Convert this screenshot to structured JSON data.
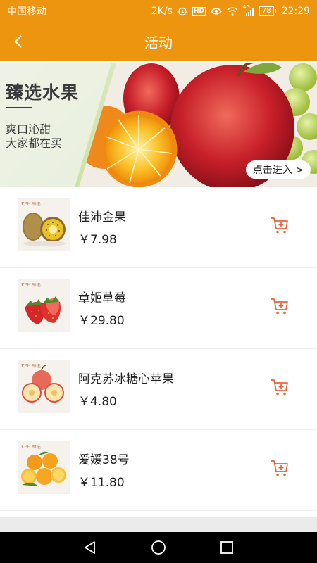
{
  "status_bar": {
    "carrier": "中国移动",
    "speed": "2K/s",
    "hd": "HD",
    "network": "4G",
    "battery": "78",
    "time": "22:29"
  },
  "header": {
    "title": "活动",
    "back_icon": "chevron-left-icon"
  },
  "banner": {
    "title": "臻选水果",
    "subtitle_line1": "爽口沁甜",
    "subtitle_line2": "大家都在买",
    "cta": "点击进入 >"
  },
  "products": [
    {
      "name": "佳沛金果",
      "price": "￥7.98",
      "thumb_logo": "KPH 臻选",
      "fruit": "kiwi"
    },
    {
      "name": "章姬草莓",
      "price": "￥29.80",
      "thumb_logo": "KPH 臻选",
      "fruit": "strawberry"
    },
    {
      "name": "阿克苏冰糖心苹果",
      "price": "￥4.80",
      "thumb_logo": "KPH 臻选",
      "fruit": "apple"
    },
    {
      "name": "爱媛38号",
      "price": "￥11.80",
      "thumb_logo": "KPH 臻选",
      "fruit": "orange"
    }
  ],
  "colors": {
    "accent": "#ee9510",
    "cart": "#e8623a"
  }
}
